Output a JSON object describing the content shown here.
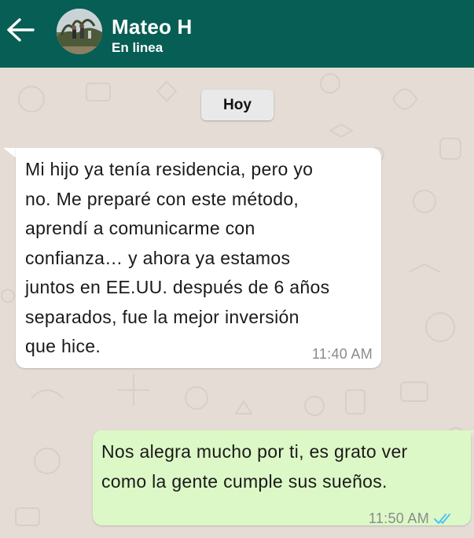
{
  "header": {
    "contact_name": "Mateo H",
    "contact_status": "En linea",
    "avatar": "avatar-photo",
    "back_icon": "arrow-left-icon"
  },
  "chat": {
    "date_chip": "Hoy",
    "messages": [
      {
        "direction": "incoming",
        "lines": [
          "Mi hijo ya tenía residencia, pero yo",
          "no. Me preparé con este método,",
          "aprendí a comunicarme con",
          "confianza… y ahora ya estamos",
          "juntos en EE.UU. después de 6 años",
          "separados, fue la mejor inversión",
          "que hice."
        ],
        "time": "11:40 AM"
      },
      {
        "direction": "outgoing",
        "lines": [
          "Nos alegra mucho por ti, es grato ver",
          "como la gente cumple sus sueños."
        ],
        "time": "11:50 AM",
        "status_icon": "double-check-read-icon"
      }
    ]
  },
  "colors": {
    "header": "#075e54",
    "chat_background": "#e5ddd5",
    "incoming_bubble": "#ffffff",
    "outgoing_bubble": "#dcf8c6",
    "read_ticks": "#4fc3f7"
  }
}
